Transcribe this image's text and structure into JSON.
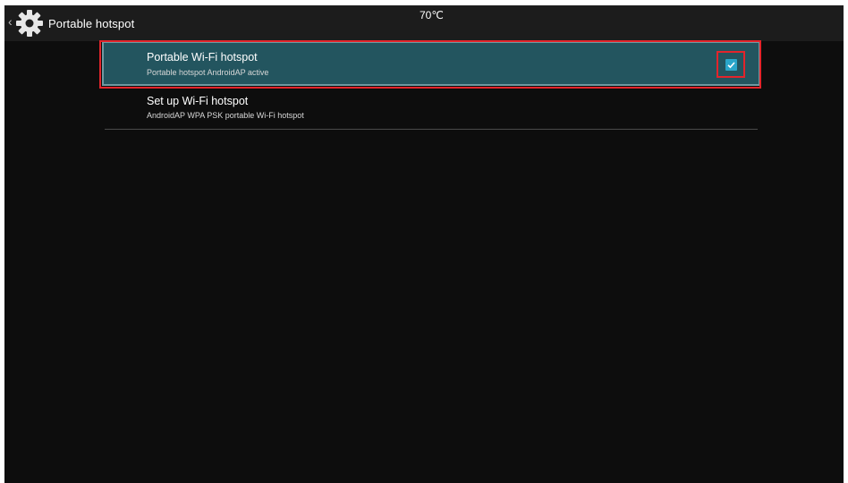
{
  "actionbar": {
    "back_icon": "chevron-left-icon",
    "settings_icon": "gear-icon",
    "title": "Portable hotspot",
    "temperature": "70℃"
  },
  "settings": [
    {
      "title": "Portable Wi-Fi hotspot",
      "summary": "Portable hotspot AndroidAP active",
      "checked": true
    },
    {
      "title": "Set up Wi-Fi hotspot",
      "summary": "AndroidAP WPA PSK portable Wi-Fi hotspot"
    }
  ],
  "colors": {
    "background": "#0d0d0d",
    "actionbar": "#1c1c1c",
    "selected_row": "#23555f",
    "checkbox": "#2aa6c9",
    "highlight_outline": "#e3242b"
  }
}
